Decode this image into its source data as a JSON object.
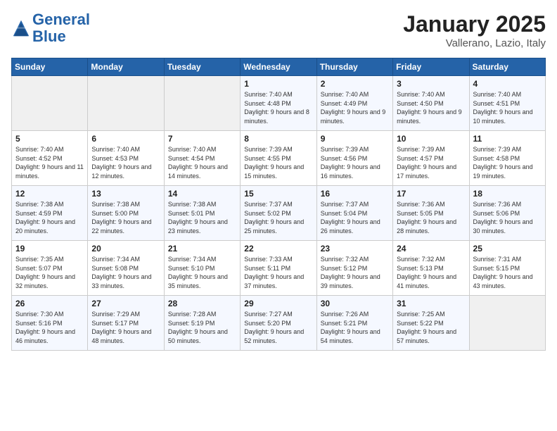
{
  "header": {
    "logo_line1": "General",
    "logo_line2": "Blue",
    "month": "January 2025",
    "location": "Vallerano, Lazio, Italy"
  },
  "days_of_week": [
    "Sunday",
    "Monday",
    "Tuesday",
    "Wednesday",
    "Thursday",
    "Friday",
    "Saturday"
  ],
  "weeks": [
    [
      {
        "num": "",
        "info": ""
      },
      {
        "num": "",
        "info": ""
      },
      {
        "num": "",
        "info": ""
      },
      {
        "num": "1",
        "info": "Sunrise: 7:40 AM\nSunset: 4:48 PM\nDaylight: 9 hours\nand 8 minutes."
      },
      {
        "num": "2",
        "info": "Sunrise: 7:40 AM\nSunset: 4:49 PM\nDaylight: 9 hours\nand 9 minutes."
      },
      {
        "num": "3",
        "info": "Sunrise: 7:40 AM\nSunset: 4:50 PM\nDaylight: 9 hours\nand 9 minutes."
      },
      {
        "num": "4",
        "info": "Sunrise: 7:40 AM\nSunset: 4:51 PM\nDaylight: 9 hours\nand 10 minutes."
      }
    ],
    [
      {
        "num": "5",
        "info": "Sunrise: 7:40 AM\nSunset: 4:52 PM\nDaylight: 9 hours\nand 11 minutes."
      },
      {
        "num": "6",
        "info": "Sunrise: 7:40 AM\nSunset: 4:53 PM\nDaylight: 9 hours\nand 12 minutes."
      },
      {
        "num": "7",
        "info": "Sunrise: 7:40 AM\nSunset: 4:54 PM\nDaylight: 9 hours\nand 14 minutes."
      },
      {
        "num": "8",
        "info": "Sunrise: 7:39 AM\nSunset: 4:55 PM\nDaylight: 9 hours\nand 15 minutes."
      },
      {
        "num": "9",
        "info": "Sunrise: 7:39 AM\nSunset: 4:56 PM\nDaylight: 9 hours\nand 16 minutes."
      },
      {
        "num": "10",
        "info": "Sunrise: 7:39 AM\nSunset: 4:57 PM\nDaylight: 9 hours\nand 17 minutes."
      },
      {
        "num": "11",
        "info": "Sunrise: 7:39 AM\nSunset: 4:58 PM\nDaylight: 9 hours\nand 19 minutes."
      }
    ],
    [
      {
        "num": "12",
        "info": "Sunrise: 7:38 AM\nSunset: 4:59 PM\nDaylight: 9 hours\nand 20 minutes."
      },
      {
        "num": "13",
        "info": "Sunrise: 7:38 AM\nSunset: 5:00 PM\nDaylight: 9 hours\nand 22 minutes."
      },
      {
        "num": "14",
        "info": "Sunrise: 7:38 AM\nSunset: 5:01 PM\nDaylight: 9 hours\nand 23 minutes."
      },
      {
        "num": "15",
        "info": "Sunrise: 7:37 AM\nSunset: 5:02 PM\nDaylight: 9 hours\nand 25 minutes."
      },
      {
        "num": "16",
        "info": "Sunrise: 7:37 AM\nSunset: 5:04 PM\nDaylight: 9 hours\nand 26 minutes."
      },
      {
        "num": "17",
        "info": "Sunrise: 7:36 AM\nSunset: 5:05 PM\nDaylight: 9 hours\nand 28 minutes."
      },
      {
        "num": "18",
        "info": "Sunrise: 7:36 AM\nSunset: 5:06 PM\nDaylight: 9 hours\nand 30 minutes."
      }
    ],
    [
      {
        "num": "19",
        "info": "Sunrise: 7:35 AM\nSunset: 5:07 PM\nDaylight: 9 hours\nand 32 minutes."
      },
      {
        "num": "20",
        "info": "Sunrise: 7:34 AM\nSunset: 5:08 PM\nDaylight: 9 hours\nand 33 minutes."
      },
      {
        "num": "21",
        "info": "Sunrise: 7:34 AM\nSunset: 5:10 PM\nDaylight: 9 hours\nand 35 minutes."
      },
      {
        "num": "22",
        "info": "Sunrise: 7:33 AM\nSunset: 5:11 PM\nDaylight: 9 hours\nand 37 minutes."
      },
      {
        "num": "23",
        "info": "Sunrise: 7:32 AM\nSunset: 5:12 PM\nDaylight: 9 hours\nand 39 minutes."
      },
      {
        "num": "24",
        "info": "Sunrise: 7:32 AM\nSunset: 5:13 PM\nDaylight: 9 hours\nand 41 minutes."
      },
      {
        "num": "25",
        "info": "Sunrise: 7:31 AM\nSunset: 5:15 PM\nDaylight: 9 hours\nand 43 minutes."
      }
    ],
    [
      {
        "num": "26",
        "info": "Sunrise: 7:30 AM\nSunset: 5:16 PM\nDaylight: 9 hours\nand 46 minutes."
      },
      {
        "num": "27",
        "info": "Sunrise: 7:29 AM\nSunset: 5:17 PM\nDaylight: 9 hours\nand 48 minutes."
      },
      {
        "num": "28",
        "info": "Sunrise: 7:28 AM\nSunset: 5:19 PM\nDaylight: 9 hours\nand 50 minutes."
      },
      {
        "num": "29",
        "info": "Sunrise: 7:27 AM\nSunset: 5:20 PM\nDaylight: 9 hours\nand 52 minutes."
      },
      {
        "num": "30",
        "info": "Sunrise: 7:26 AM\nSunset: 5:21 PM\nDaylight: 9 hours\nand 54 minutes."
      },
      {
        "num": "31",
        "info": "Sunrise: 7:25 AM\nSunset: 5:22 PM\nDaylight: 9 hours\nand 57 minutes."
      },
      {
        "num": "",
        "info": ""
      }
    ]
  ]
}
